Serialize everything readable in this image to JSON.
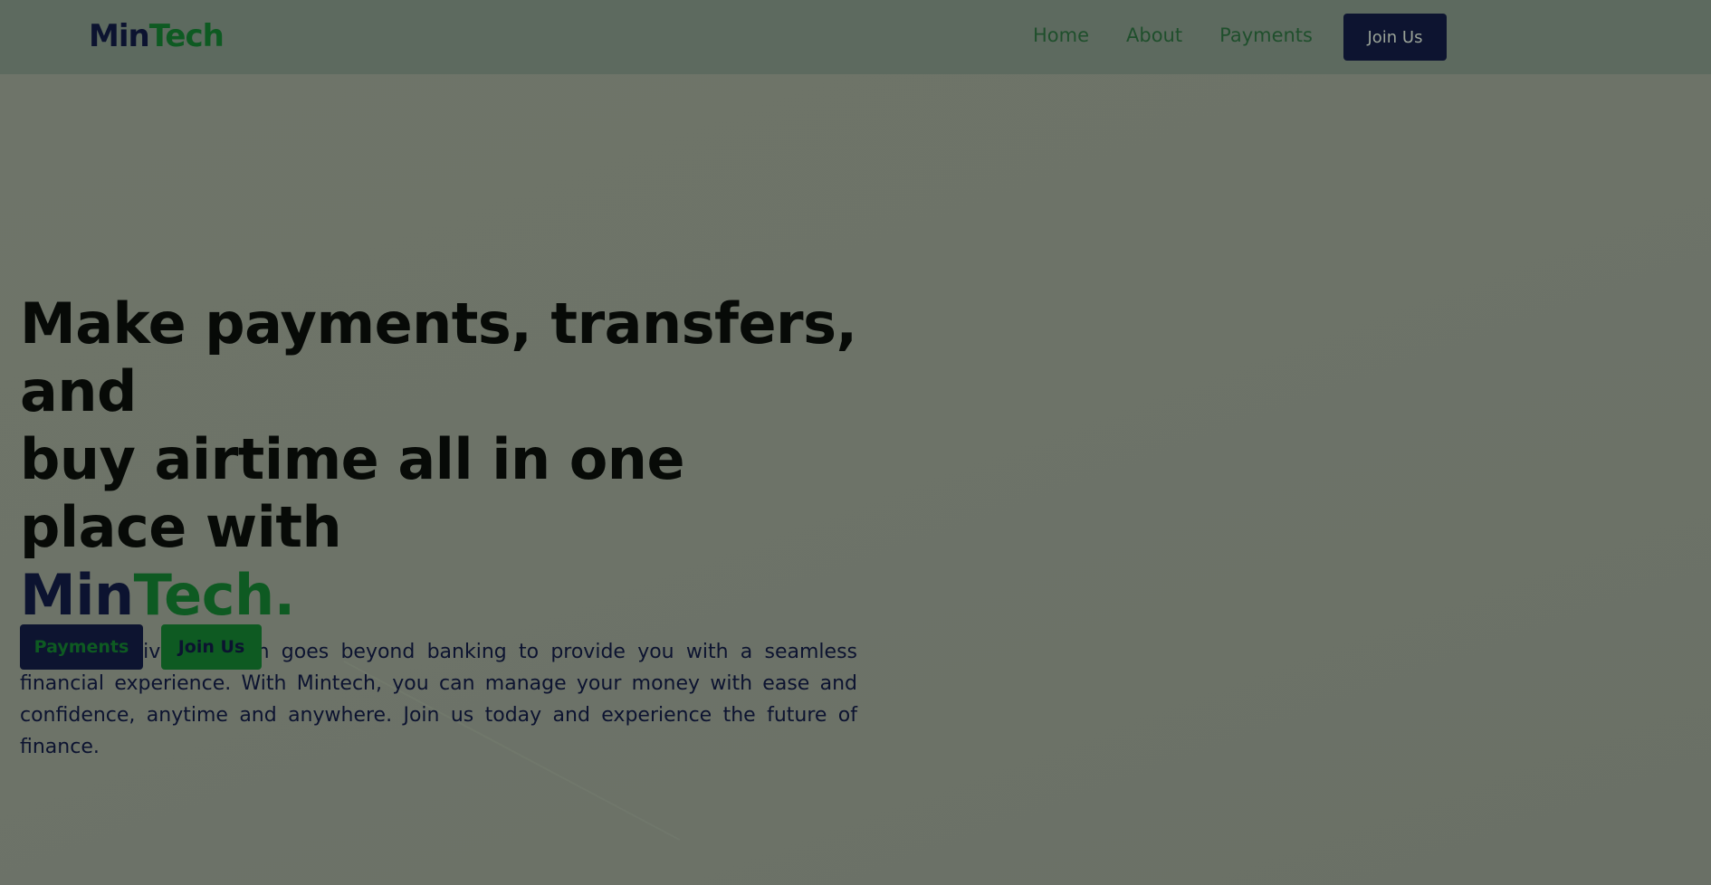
{
  "logo": {
    "part1": "Min",
    "part2": "Tech"
  },
  "nav": {
    "links": [
      "Home",
      "About",
      "Payments"
    ],
    "join_label": "Join Us"
  },
  "hero": {
    "title_line1": "Make payments, transfers, and",
    "title_line2": "buy airtime all in one place with",
    "brand_min": "Min",
    "brand_tech": "Tech.",
    "description": "Our innovative platform goes beyond banking to provide you with a seamless financial experience. With Mintech, you can manage your money with ease and confidence, anytime and anywhere. Join us today and experience the future of finance.",
    "payments_label": "Payments",
    "join_label": "Join Us"
  },
  "colors": {
    "navy": "#0c1330",
    "green": "#0e5a22",
    "overlay": "#6d7368"
  }
}
